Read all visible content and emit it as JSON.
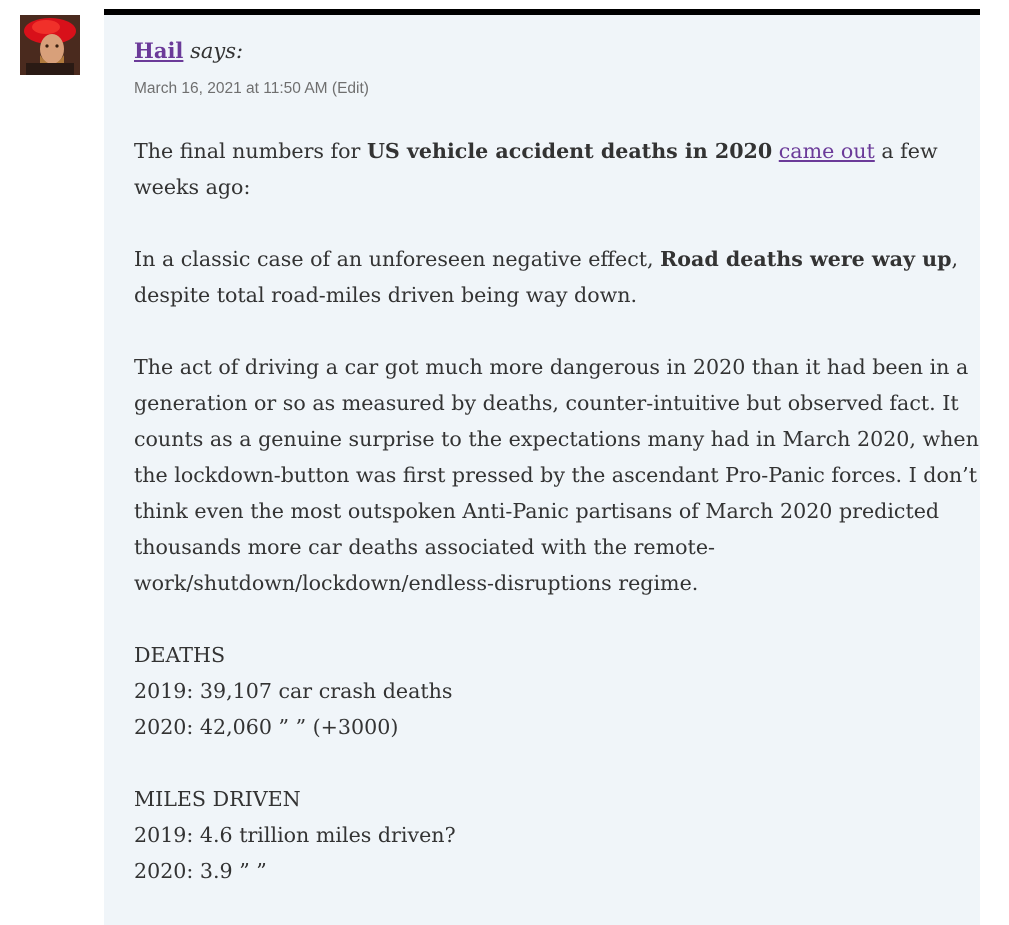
{
  "comment": {
    "author": "Hail",
    "says": "says:",
    "timestamp": "March 16, 2021 at 11:50 AM",
    "edit_link": "(Edit)",
    "p1": {
      "pre": "The final numbers for ",
      "bold": "US vehicle accident deaths in 2020",
      "mid": " ",
      "link": "came out",
      "post": " a few weeks ago:"
    },
    "p2": {
      "pre": "In a classic case of an unforeseen negative effect, ",
      "bold": "Road deaths were way up",
      "post": ", despite total road-miles driven being way down."
    },
    "p3": "The act of driving a car got much more dangerous in 2020 than it had been in a generation or so as measured by deaths, counter-intuitive but observed fact. It counts as a genuine surprise to the expectations many had in March 2020, when the lockdown-button was first pressed by the ascendant Pro-Panic forces. I don’t think even the most outspoken Anti-Panic partisans of March 2020 predicted thousands more car deaths associated with the remote-work/shutdown/lockdown/endless-disruptions regime.",
    "deaths": {
      "heading": "DEATHS",
      "line2019": "2019: 39,107 car crash deaths",
      "line2020": "2020: 42,060 ” ” (+3000)"
    },
    "miles": {
      "heading": "MILES DRIVEN",
      "line2019": "2019: 4.6 trillion miles driven?",
      "line2020": "2020: 3.9 ” ”"
    }
  },
  "colors": {
    "link": "#6b3a99",
    "panel_bg": "#f0f5f9",
    "top_border": "#000000",
    "text": "#333333"
  }
}
